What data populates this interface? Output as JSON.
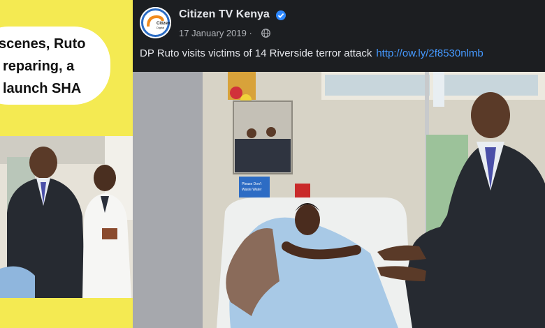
{
  "left_panel": {
    "headline_lines": [
      "scenes, Ruto",
      "reparing, a",
      "launch SHA"
    ]
  },
  "post": {
    "page_name": "Citizen TV Kenya",
    "date": "17 January 2019 ·",
    "caption": "DP Ruto visits victims of 14 Riverside terror attack",
    "link": "http://ow.ly/2f8530nlmb",
    "avatar_text": "Citizen Digital",
    "poster_text": "Please Don't Waste Water"
  },
  "colors": {
    "banner": "#f4ea52",
    "header_bg": "#1c1e21",
    "link": "#4599ff",
    "verified": "#2d88ff"
  }
}
